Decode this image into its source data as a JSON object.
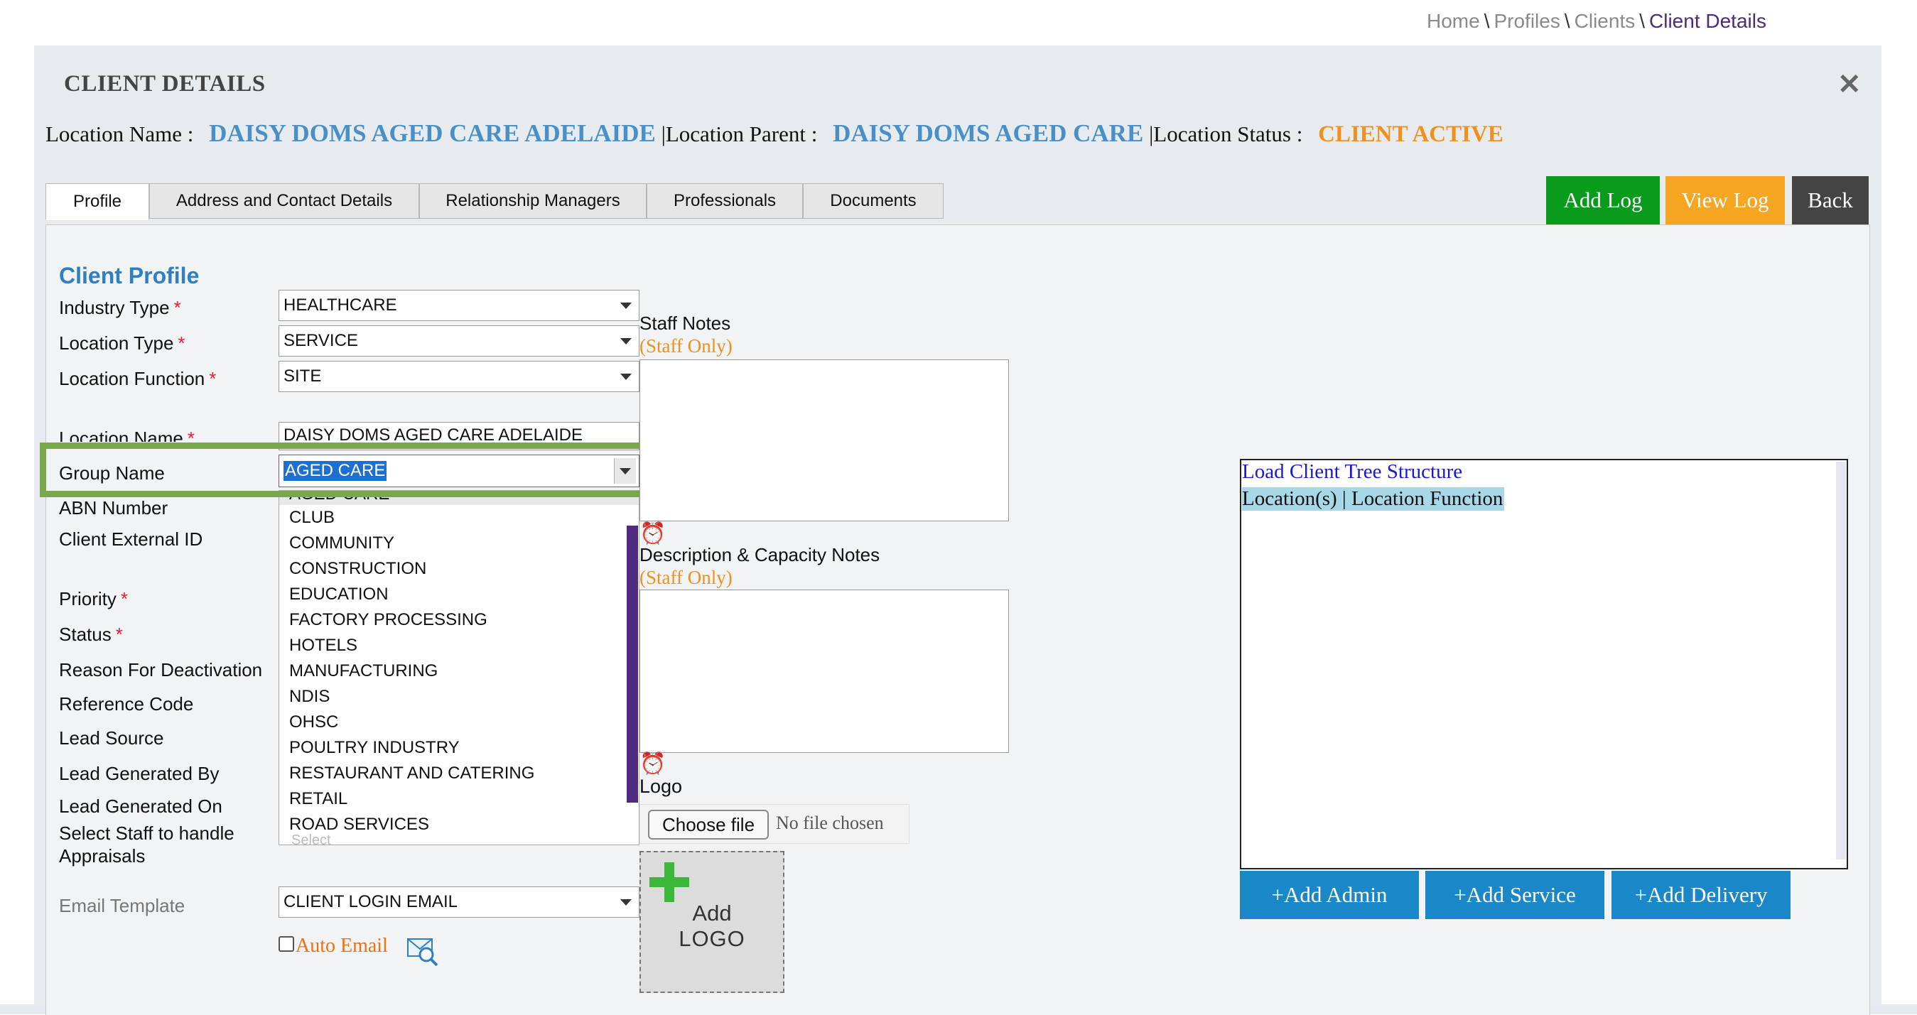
{
  "breadcrumb": {
    "home": "Home",
    "profiles": "Profiles",
    "clients": "Clients",
    "current": "Client Details",
    "sep": "\\"
  },
  "header": {
    "title": "CLIENT DETAILS"
  },
  "location_line": {
    "name_label": "Location Name :",
    "name_value": "DAISY DOMS AGED CARE ADELAIDE",
    "parent_label": "|Location Parent :",
    "parent_value": "DAISY DOMS AGED CARE",
    "status_label": "|Location Status :",
    "status_value": "CLIENT ACTIVE"
  },
  "tabs": [
    "Profile",
    "Address and Contact Details",
    "Relationship Managers",
    "Professionals",
    "Documents"
  ],
  "actions": {
    "add_log": "Add Log",
    "view_log": "View Log",
    "back": "Back"
  },
  "colors": {
    "add_log": "#0a9a1c",
    "view_log": "#f6a623",
    "back": "#444444",
    "highlight": "#79a84a",
    "brand_blue": "#2f7fc1"
  },
  "profile": {
    "heading": "Client Profile",
    "labels": {
      "industry_type": "Industry Type",
      "location_type": "Location Type",
      "location_function": "Location Function",
      "location_name": "Location Name",
      "group_name": "Group Name",
      "abn_number": "ABN Number",
      "client_external_id": "Client External ID",
      "priority": "Priority",
      "status": "Status",
      "reason_for_deactivation": "Reason For Deactivation",
      "reference_code": "Reference Code",
      "lead_source": "Lead Source",
      "lead_generated_by": "Lead Generated By",
      "lead_generated_on": "Lead Generated On",
      "select_staff_1": "Select Staff to handle",
      "select_staff_2": "Appraisals",
      "email_template": "Email Template"
    },
    "required_mark": "*",
    "values": {
      "industry_type": "HEALTHCARE",
      "location_type": "SERVICE",
      "location_function": "SITE",
      "location_name": "DAISY DOMS AGED CARE ADELAIDE",
      "group_name": "AGED CARE",
      "email_template": "CLIENT LOGIN EMAIL",
      "select_staff_placeholder": "Select"
    },
    "auto_email": "Auto Email"
  },
  "group_dropdown_options": [
    "AGED CARE",
    "CLUB",
    "COMMUNITY",
    "CONSTRUCTION",
    "EDUCATION",
    "FACTORY PROCESSING",
    "HOTELS",
    "MANUFACTURING",
    "NDIS",
    "OHSC",
    "POULTRY INDUSTRY",
    "RESTAURANT AND CATERING",
    "RETAIL",
    "ROAD SERVICES"
  ],
  "notes": {
    "staff_notes": "Staff Notes",
    "staff_only": "(Staff Only)",
    "description": "Description & Capacity Notes",
    "description_staff_only": "(Staff Only)",
    "logo": "Logo",
    "choose_file": "Choose file",
    "no_file": "No file chosen",
    "add_logo_1": "Add",
    "add_logo_2": "LOGO"
  },
  "tree": {
    "load_link": "Load Client Tree Structure",
    "header": "Location(s) | Location Function"
  },
  "tree_buttons": {
    "add_admin": "+Add Admin",
    "add_service": "+Add Service",
    "add_delivery": "+Add Delivery"
  }
}
